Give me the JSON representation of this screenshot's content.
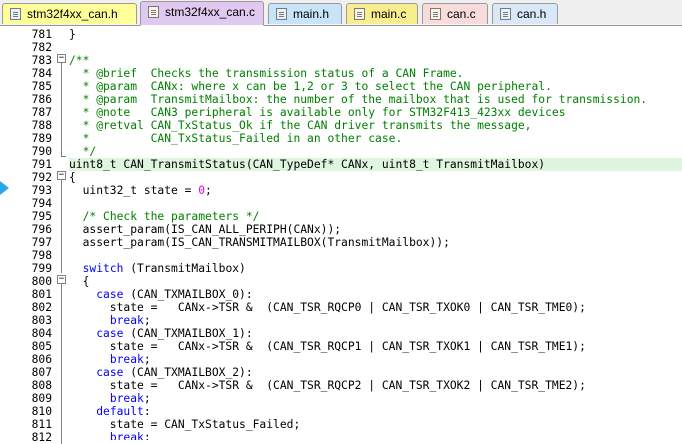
{
  "tabs": [
    {
      "label": "stm32f4xx_can.h",
      "color": "#ffff99",
      "active": false,
      "icon": "header-file-icon"
    },
    {
      "label": "stm32f4xx_can.c",
      "color": "#e0c8f0",
      "active": true,
      "icon": "source-file-icon"
    },
    {
      "label": "main.h",
      "color": "#c8e4f8",
      "active": false,
      "icon": "header-file-icon"
    },
    {
      "label": "main.c",
      "color": "#f8ee90",
      "active": false,
      "icon": "source-file-icon"
    },
    {
      "label": "can.c",
      "color": "#f8dcdc",
      "active": false,
      "icon": "source-file-icon"
    },
    {
      "label": "can.h",
      "color": "#d8e8f8",
      "active": false,
      "icon": "header-file-icon"
    }
  ],
  "editor": {
    "current_line": 791,
    "lines": [
      {
        "n": "781",
        "segs": [
          {
            "t": "}",
            "c": ""
          }
        ]
      },
      {
        "n": "782",
        "segs": []
      },
      {
        "n": "783",
        "segs": [
          {
            "t": "/**",
            "c": "cm"
          }
        ]
      },
      {
        "n": "784",
        "segs": [
          {
            "t": "  * @brief  Checks the transmission status of a CAN Frame.",
            "c": "cm"
          }
        ]
      },
      {
        "n": "785",
        "segs": [
          {
            "t": "  * @param  CANx: where x can be 1,2 or 3 to select the CAN peripheral.",
            "c": "cm"
          }
        ]
      },
      {
        "n": "786",
        "segs": [
          {
            "t": "  * @param  TransmitMailbox: the number of the mailbox that is used for transmission.",
            "c": "cm"
          }
        ]
      },
      {
        "n": "787",
        "segs": [
          {
            "t": "  * @note   CAN3 peripheral is available only for STM32F413_423xx devices",
            "c": "cm"
          }
        ]
      },
      {
        "n": "788",
        "segs": [
          {
            "t": "  * @retval CAN_TxStatus_Ok if the CAN driver transmits the message,",
            "c": "cm"
          }
        ]
      },
      {
        "n": "789",
        "segs": [
          {
            "t": "  *         CAN_TxStatus_Failed in an other case.",
            "c": "cm"
          }
        ]
      },
      {
        "n": "790",
        "segs": [
          {
            "t": "  */",
            "c": "cm"
          }
        ]
      },
      {
        "n": "791",
        "segs": [
          {
            "t": "uint8_t CAN_TransmitStatus(CAN_TypeDef* CANx, uint8_t TransmitMailbox)",
            "c": ""
          }
        ]
      },
      {
        "n": "792",
        "segs": [
          {
            "t": "{",
            "c": ""
          }
        ]
      },
      {
        "n": "793",
        "segs": [
          {
            "t": "  uint32_t state = ",
            "c": ""
          },
          {
            "t": "0",
            "c": "nm"
          },
          {
            "t": ";",
            "c": ""
          }
        ]
      },
      {
        "n": "794",
        "segs": []
      },
      {
        "n": "795",
        "segs": [
          {
            "t": "  ",
            "c": ""
          },
          {
            "t": "/* Check the parameters */",
            "c": "cm"
          }
        ]
      },
      {
        "n": "796",
        "segs": [
          {
            "t": "  assert_param(IS_CAN_ALL_PERIPH(CANx));",
            "c": ""
          }
        ]
      },
      {
        "n": "797",
        "segs": [
          {
            "t": "  assert_param(IS_CAN_TRANSMITMAILBOX(TransmitMailbox));",
            "c": ""
          }
        ]
      },
      {
        "n": "798",
        "segs": []
      },
      {
        "n": "799",
        "segs": [
          {
            "t": "  ",
            "c": ""
          },
          {
            "t": "switch",
            "c": "kw"
          },
          {
            "t": " (TransmitMailbox)",
            "c": ""
          }
        ]
      },
      {
        "n": "800",
        "segs": [
          {
            "t": "  {",
            "c": ""
          }
        ]
      },
      {
        "n": "801",
        "segs": [
          {
            "t": "    ",
            "c": ""
          },
          {
            "t": "case",
            "c": "kw"
          },
          {
            "t": " (CAN_TXMAILBOX_0):",
            "c": ""
          }
        ]
      },
      {
        "n": "802",
        "segs": [
          {
            "t": "      state =   CANx->TSR &  (CAN_TSR_RQCP0 | CAN_TSR_TXOK0 | CAN_TSR_TME0);",
            "c": ""
          }
        ]
      },
      {
        "n": "803",
        "segs": [
          {
            "t": "      ",
            "c": ""
          },
          {
            "t": "break",
            "c": "kw"
          },
          {
            "t": ";",
            "c": ""
          }
        ]
      },
      {
        "n": "804",
        "segs": [
          {
            "t": "    ",
            "c": ""
          },
          {
            "t": "case",
            "c": "kw"
          },
          {
            "t": " (CAN_TXMAILBOX_1):",
            "c": ""
          }
        ]
      },
      {
        "n": "805",
        "segs": [
          {
            "t": "      state =   CANx->TSR &  (CAN_TSR_RQCP1 | CAN_TSR_TXOK1 | CAN_TSR_TME1);",
            "c": ""
          }
        ]
      },
      {
        "n": "806",
        "segs": [
          {
            "t": "      ",
            "c": ""
          },
          {
            "t": "break",
            "c": "kw"
          },
          {
            "t": ";",
            "c": ""
          }
        ]
      },
      {
        "n": "807",
        "segs": [
          {
            "t": "    ",
            "c": ""
          },
          {
            "t": "case",
            "c": "kw"
          },
          {
            "t": " (CAN_TXMAILBOX_2):",
            "c": ""
          }
        ]
      },
      {
        "n": "808",
        "segs": [
          {
            "t": "      state =   CANx->TSR &  (CAN_TSR_RQCP2 | CAN_TSR_TXOK2 | CAN_TSR_TME2);",
            "c": ""
          }
        ]
      },
      {
        "n": "809",
        "segs": [
          {
            "t": "      ",
            "c": ""
          },
          {
            "t": "break",
            "c": "kw"
          },
          {
            "t": ";",
            "c": ""
          }
        ]
      },
      {
        "n": "810",
        "segs": [
          {
            "t": "    ",
            "c": ""
          },
          {
            "t": "default",
            "c": "kw"
          },
          {
            "t": ":",
            "c": ""
          }
        ]
      },
      {
        "n": "811",
        "segs": [
          {
            "t": "      state = CAN_TxStatus_Failed;",
            "c": ""
          }
        ]
      },
      {
        "n": "812",
        "segs": [
          {
            "t": "      ",
            "c": ""
          },
          {
            "t": "break",
            "c": "kw"
          },
          {
            "t": ";",
            "c": ""
          }
        ]
      }
    ]
  }
}
